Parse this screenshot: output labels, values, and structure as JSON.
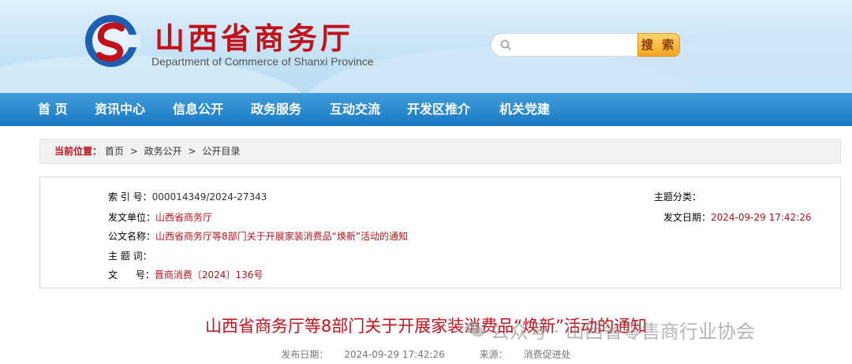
{
  "header": {
    "title": "山西省商务厅",
    "subtitle": "Department of Commerce of Shanxi Province",
    "logo_icon": "shanxi-commerce-logo",
    "search_placeholder": "",
    "search_button": "搜 索"
  },
  "nav": {
    "items": [
      "首 页",
      "资讯中心",
      "信息公开",
      "政务服务",
      "互动交流",
      "开发区推介",
      "机关党建"
    ]
  },
  "breadcrumb": {
    "label": "当前位置：",
    "items": [
      "首页",
      "政务公开",
      "公开目录"
    ],
    "separator": ">"
  },
  "meta": {
    "index_label": "索 引 号：",
    "index_value": "000014349/2024-27343",
    "category_label": "主题分类：",
    "category_value": "",
    "issuer_label": "发文单位：",
    "issuer_value": "山西省商务厅",
    "date_label": "发文日期：",
    "date_value": "2024-09-29 17:42:26",
    "doc_name_label": "公文名称：",
    "doc_name_value": "山西省商务厅等8部门关于开展家装消费品“焕新”活动的通知",
    "keywords_label": "主 题 词：",
    "keywords_value": "",
    "doc_no_label": "文      号：",
    "doc_no_value": "晋商消费〔2024〕136号"
  },
  "article": {
    "title": "山西省商务厅等8部门关于开展家装消费品“焕新”活动的通知",
    "publish_label": "发布日期：",
    "publish_value": "2024-09-29 17:42:26",
    "source_label": "来源：",
    "source_value": "消费促进处"
  },
  "watermark": {
    "text": "公众号 · 山西省零售商行业协会",
    "icon": "wechat-icon"
  },
  "colors": {
    "brand_red": "#c1121c",
    "nav_blue": "#1a78c2",
    "search_orange": "#f5a623"
  }
}
